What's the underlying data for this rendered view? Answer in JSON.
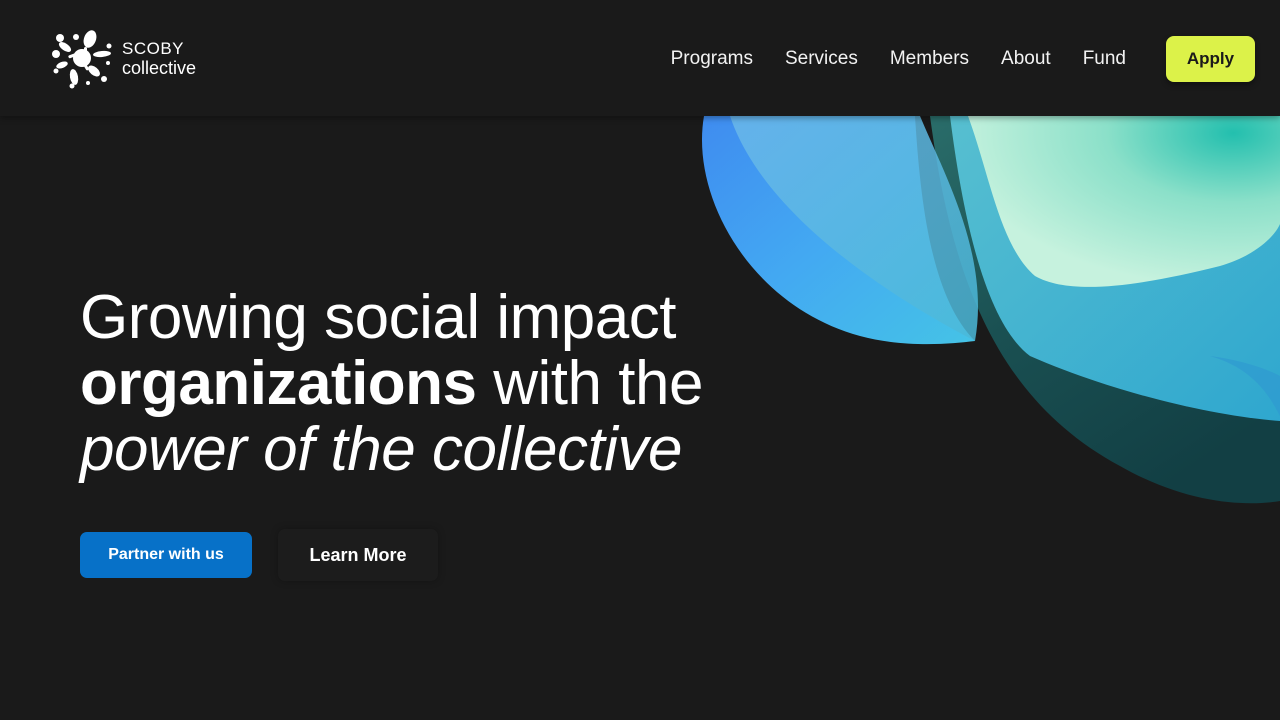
{
  "brand": {
    "line1": "SCOBY",
    "line2": "collective",
    "logo_icon": "splash-logo-icon"
  },
  "nav": {
    "items": [
      {
        "label": "Programs"
      },
      {
        "label": "Services"
      },
      {
        "label": "Members"
      },
      {
        "label": "About"
      },
      {
        "label": "Fund"
      }
    ],
    "apply_label": "Apply"
  },
  "hero": {
    "line1": "Growing social impact",
    "line2_bold": "organizations",
    "line2_rest": " with the",
    "line3_italic": "power of the collective",
    "primary_cta": "Partner with us",
    "secondary_cta": "Learn More"
  },
  "colors": {
    "background": "#1a1a1a",
    "apply_button": "#dcf249",
    "primary_button": "#0771c8",
    "text": "#ffffff"
  }
}
